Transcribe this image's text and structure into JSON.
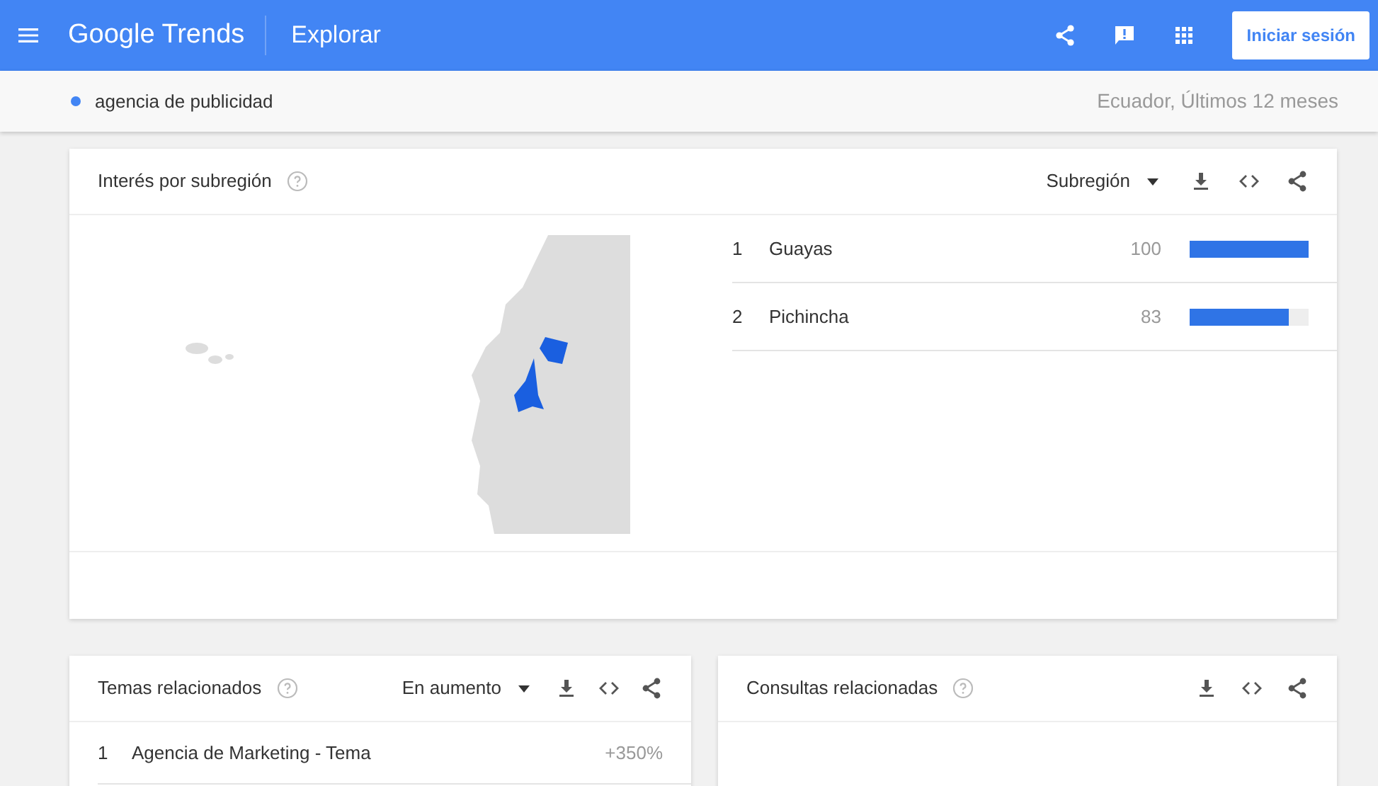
{
  "header": {
    "logo": "Google Trends",
    "title": "Explorar",
    "sign_in": "Iniciar sesión"
  },
  "search_term": {
    "label": "agencia de publicidad",
    "color": "#4285f4",
    "context": "Ecuador, Últimos 12 meses"
  },
  "subregion_card": {
    "title": "Interés por subregión",
    "dropdown": "Subregión",
    "rows": [
      {
        "rank": "1",
        "name": "Guayas",
        "value": "100",
        "level": 1.0
      },
      {
        "rank": "2",
        "name": "Pichincha",
        "value": "83",
        "level": 0.83
      }
    ]
  },
  "related_topics": {
    "title": "Temas relacionados",
    "dropdown": "En aumento",
    "rows": [
      {
        "rank": "1",
        "name": "Agencia de Marketing - Tema",
        "value": "+350%"
      }
    ]
  },
  "related_queries": {
    "title": "Consultas relacionadas"
  }
}
